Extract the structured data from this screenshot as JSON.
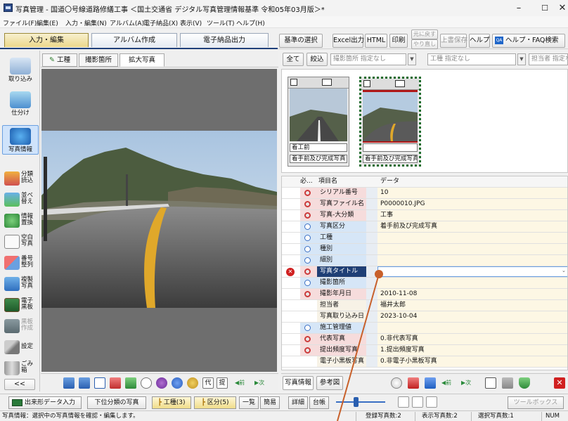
{
  "window": {
    "title": "写真管理 - 国道〇号線道路修繕工事 ＜国土交通省 デジタル写真管理情報基準 令和05年03月版＞*",
    "controls": {
      "minimize": "–",
      "maximize": "☐",
      "close": "✕"
    }
  },
  "menu": [
    "ファイル(F)",
    "編集(E)",
    "入力・編集(N)",
    "アルバム(A)",
    "電子納品(X)",
    "表示(V)",
    "ツール(T)",
    "ヘルプ(H)"
  ],
  "mode_tabs": [
    "入力・編集",
    "アルバム作成",
    "電子納品出力"
  ],
  "toolbar": {
    "kijun": "基準の選択",
    "excel": "Excel出力",
    "html": "HTML",
    "print": "印刷",
    "undo": "元に戻す",
    "redo": "やり直し",
    "overwrite": "上書保存",
    "help": "ヘルプ",
    "faq": "ヘルプ・FAQ検索"
  },
  "left_tools": {
    "import": "取り込み",
    "sort": "仕分け",
    "photo_info": "写真情報",
    "bunrui1": "分類",
    "bunrui2": "読込",
    "narabe1": "並べ",
    "narabe2": "替え",
    "joho1": "情報",
    "joho2": "置換",
    "kuhaku1": "空白",
    "kuhaku2": "写真",
    "bango1": "番号",
    "bango2": "整列",
    "fukusei1": "複製",
    "fukusei2": "写真",
    "denshi1": "電子",
    "denshi2": "黒板",
    "kokuban1": "黒板",
    "kokuban2": "作成",
    "settings": "設定",
    "trash1": "ごみ",
    "trash2": "箱",
    "collapse": "<<"
  },
  "sub_tabs": {
    "koushu": "工種",
    "basho": "撮影箇所",
    "kakudai": "拡大写真"
  },
  "filters": {
    "all": "全て",
    "narrow": "絞込",
    "place": "撮影箇所 指定なし",
    "koushu": "工種 指定なし",
    "person": "担当者 指定なし"
  },
  "thumbnails": [
    {
      "caption1": "着工前",
      "caption2": "着手前及び完成写真"
    },
    {
      "caption1": "",
      "caption2": "着手前及び完成写真"
    }
  ],
  "props": {
    "header": {
      "req": "必...",
      "name": "項目名",
      "value": "データ"
    },
    "rows": [
      {
        "mark": "req",
        "name": "シリアル番号",
        "value": "10"
      },
      {
        "mark": "req",
        "name": "写真ファイル名",
        "value": "P0000010.JPG"
      },
      {
        "mark": "req",
        "name": "写真-大分類",
        "value": "工事"
      },
      {
        "mark": "opt",
        "name": "写真区分",
        "value": "着手前及び完成写真"
      },
      {
        "mark": "opt",
        "name": "工種",
        "value": ""
      },
      {
        "mark": "opt",
        "name": "種別",
        "value": ""
      },
      {
        "mark": "opt",
        "name": "細別",
        "value": ""
      },
      {
        "mark": "req",
        "name": "写真タイトル",
        "value": "",
        "selected": true,
        "error": true
      },
      {
        "mark": "opt",
        "name": "撮影箇所",
        "value": ""
      },
      {
        "mark": "req",
        "name": "撮影年月日",
        "value": "2010-11-08"
      },
      {
        "mark": "",
        "name": "担当者",
        "value": "福井太郎"
      },
      {
        "mark": "",
        "name": "写真取り込み日",
        "value": "2023-10-04"
      },
      {
        "mark": "opt",
        "name": "施工管理値",
        "value": ""
      },
      {
        "mark": "req",
        "name": "代表写真",
        "value": "0.非代表写真"
      },
      {
        "mark": "req",
        "name": "提出頻度写真",
        "value": "1.提出頻度写真"
      },
      {
        "mark": "",
        "name": "電子小黒板写真",
        "value": "0.非電子小黒板写真"
      }
    ]
  },
  "bottom_tb": {
    "prev": "前",
    "next": "次",
    "dai": "代",
    "tei": "提"
  },
  "right_tb": {
    "photo_info_tab": "写真情報",
    "ref_tab": "参考図",
    "prev": "前",
    "next": "次"
  },
  "footer": {
    "dekigata": "出来形データ入力",
    "lower": "下位分類の写真",
    "koushu": "工種(3)",
    "kubun": "区分(5)",
    "ichiran": "一覧",
    "kani": "簡易",
    "shosai": "詳細",
    "daicho": "台帳",
    "toolbox": "ツールボックス"
  },
  "status": {
    "message": "写真情報：選択中の写真情報を確認・編集します。",
    "registered": "登録写真数:2",
    "shown": "表示写真数:2",
    "selected": "選択写真数:1",
    "num": "NUM"
  }
}
